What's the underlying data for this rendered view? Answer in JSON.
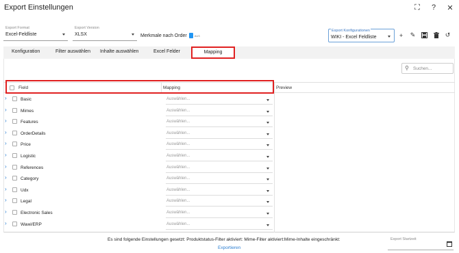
{
  "window": {
    "title": "Export Einstellungen"
  },
  "titlebar_icons": [
    "fullscreen-icon",
    "help-icon",
    "close-icon"
  ],
  "topbar": {
    "format": {
      "label": "Export Format",
      "value": "Excel-Feldliste"
    },
    "version": {
      "label": "Export Version",
      "value": "XLSX"
    },
    "merkmale": {
      "label": "Merkmale nach Order",
      "toggle_text": "AUS"
    },
    "konfiguration": {
      "label": "Export Konfigurationen",
      "value": "WIKI - Excel Feldliste"
    },
    "actions": [
      "add-icon",
      "edit-icon",
      "save-icon",
      "delete-icon",
      "undo-icon"
    ]
  },
  "tabs": [
    {
      "label": "Konfiguration"
    },
    {
      "label": "Filter auswählen"
    },
    {
      "label": "Inhalte auswählen"
    },
    {
      "label": "Excel Felder"
    },
    {
      "label": "Mapping",
      "active": true
    }
  ],
  "search": {
    "placeholder": "Suchen..."
  },
  "table": {
    "headers": {
      "field": "Field",
      "mapping": "Mapping",
      "preview": "Preview"
    },
    "mapping_placeholder": "Auswählen...",
    "rows": [
      {
        "name": "Basic",
        "mapping": "Auswählen..."
      },
      {
        "name": "Mimes",
        "mapping": "Auswählen..."
      },
      {
        "name": "Features",
        "mapping": "Auswählen..."
      },
      {
        "name": "OrderDetails",
        "mapping": "Auswählen..."
      },
      {
        "name": "Price",
        "mapping": "Auswählen..."
      },
      {
        "name": "Logistic",
        "mapping": "Auswählen..."
      },
      {
        "name": "References",
        "mapping": "Auswählen..."
      },
      {
        "name": "Category",
        "mapping": "Auswählen..."
      },
      {
        "name": "Udx",
        "mapping": "Auswählen..."
      },
      {
        "name": "Legal",
        "mapping": "Auswählen..."
      },
      {
        "name": "Electronic Sales",
        "mapping": "Auswählen..."
      },
      {
        "name": "Wawi/ERP",
        "mapping": "Auswählen..."
      }
    ]
  },
  "footer": {
    "info": "Es sind folgende Einstellungen gesetzt: Produktstatus-Filter aktiviert: Mime-Filter aktiviert:Mime-Inhalte eingeschränkt:",
    "export_label": "Exportieren",
    "startzeit_label": "Export Startzeit"
  },
  "colors": {
    "accent": "#2a7dd1",
    "highlight": "#e02020",
    "toggle": "#2196f3"
  }
}
